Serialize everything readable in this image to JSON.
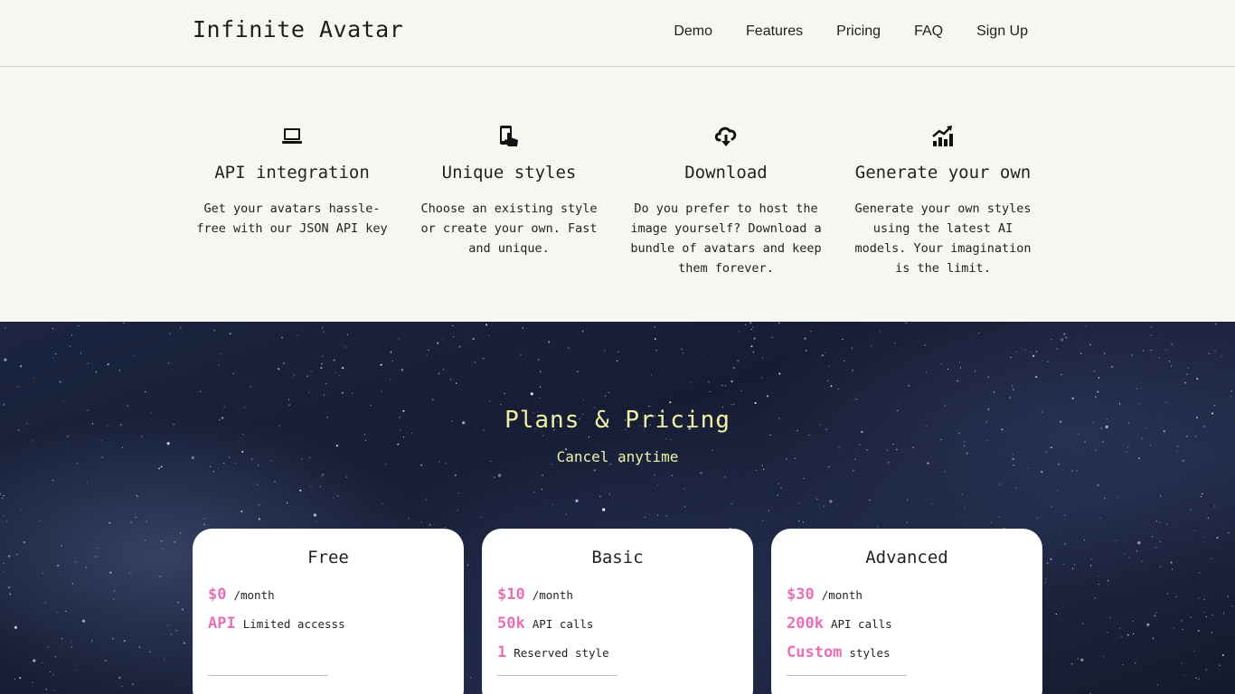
{
  "header": {
    "brand": "Infinite Avatar",
    "nav": [
      "Demo",
      "Features",
      "Pricing",
      "FAQ",
      "Sign Up"
    ]
  },
  "features": [
    {
      "icon": "laptop-icon",
      "title": "API integration",
      "desc": "Get your avatars hassle-free with our JSON API key"
    },
    {
      "icon": "touch-phone-icon",
      "title": "Unique styles",
      "desc": "Choose an existing style or create your own. Fast and unique."
    },
    {
      "icon": "cloud-download-icon",
      "title": "Download",
      "desc": "Do you prefer to host the image yourself? Download a bundle of avatars and keep them forever."
    },
    {
      "icon": "chart-growth-icon",
      "title": "Generate your own",
      "desc": "Generate your own styles using the latest AI models. Your imagination is the limit."
    }
  ],
  "pricing": {
    "title": "Plans & Pricing",
    "subtitle": "Cancel anytime",
    "plans": [
      {
        "name": "Free",
        "rows": [
          {
            "big": "$0",
            "small": "/month"
          },
          {
            "big": "API",
            "small": "Limited accesss"
          }
        ]
      },
      {
        "name": "Basic",
        "rows": [
          {
            "big": "$10",
            "small": "/month"
          },
          {
            "big": "50k",
            "small": "API calls"
          },
          {
            "big": "1",
            "small": "Reserved style"
          }
        ]
      },
      {
        "name": "Advanced",
        "rows": [
          {
            "big": "$30",
            "small": "/month"
          },
          {
            "big": "200k",
            "small": "API calls"
          },
          {
            "big": "Custom",
            "small": "styles"
          }
        ]
      }
    ]
  },
  "colors": {
    "accent_pink": "#e86fb8",
    "title_yellow": "#f3f0a6",
    "page_bg": "#f7f7f2"
  }
}
